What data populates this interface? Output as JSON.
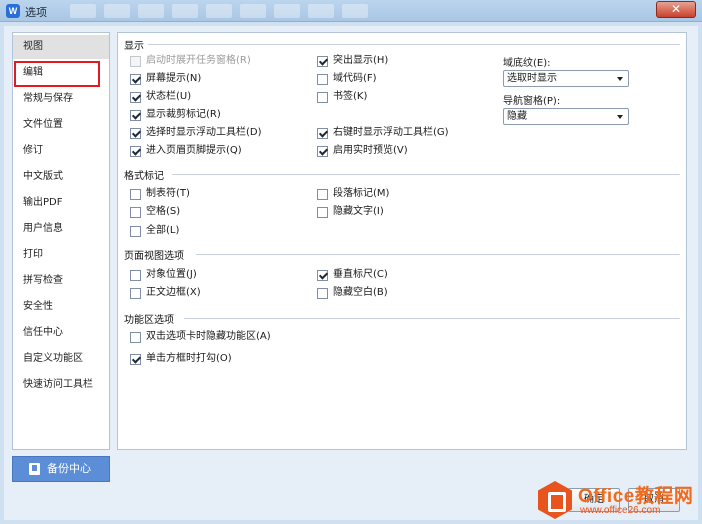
{
  "window": {
    "title": "选项",
    "close_glyph": "✕",
    "app_icon_glyph": "W"
  },
  "sidebar": {
    "selected_index": 0,
    "items": [
      {
        "label": "视图"
      },
      {
        "label": "编辑"
      },
      {
        "label": "常规与保存"
      },
      {
        "label": "文件位置"
      },
      {
        "label": "修订"
      },
      {
        "label": "中文版式"
      },
      {
        "label": "输出PDF"
      },
      {
        "label": "用户信息"
      },
      {
        "label": "打印"
      },
      {
        "label": "拼写检查"
      },
      {
        "label": "安全性"
      },
      {
        "label": "信任中心"
      },
      {
        "label": "自定义功能区"
      },
      {
        "label": "快速访问工具栏"
      }
    ]
  },
  "display": {
    "title": "显示",
    "options": [
      {
        "label": "启动时展开任务窗格(R)",
        "checked": false,
        "disabled": true
      },
      {
        "label": "屏幕提示(N)",
        "checked": true,
        "disabled": false
      },
      {
        "label": "状态栏(U)",
        "checked": true,
        "disabled": false
      },
      {
        "label": "显示裁剪标记(R)",
        "checked": true,
        "disabled": false
      },
      {
        "label": "选择时显示浮动工具栏(D)",
        "checked": true,
        "disabled": false
      },
      {
        "label": "进入页眉页脚提示(Q)",
        "checked": true,
        "disabled": false
      },
      {
        "label": "突出显示(H)",
        "checked": true,
        "disabled": false
      },
      {
        "label": "域代码(F)",
        "checked": false,
        "disabled": false
      },
      {
        "label": "书签(K)",
        "checked": false,
        "disabled": false
      },
      {
        "label": "右键时显示浮动工具栏(G)",
        "checked": true,
        "disabled": false
      },
      {
        "label": "启用实时预览(V)",
        "checked": true,
        "disabled": false
      }
    ],
    "field_shading": {
      "label": "域底纹(E):",
      "value": "选取时显示"
    },
    "nav_pane": {
      "label": "导航窗格(P):",
      "value": "隐藏"
    }
  },
  "format_marks": {
    "title": "格式标记",
    "options": [
      {
        "label": "制表符(T)",
        "checked": false
      },
      {
        "label": "空格(S)",
        "checked": false
      },
      {
        "label": "全部(L)",
        "checked": false
      },
      {
        "label": "段落标记(M)",
        "checked": false
      },
      {
        "label": "隐藏文字(I)",
        "checked": false
      }
    ]
  },
  "page_view": {
    "title": "页面视图选项",
    "options": [
      {
        "label": "对象位置(J)",
        "checked": false
      },
      {
        "label": "正文边框(X)",
        "checked": false
      },
      {
        "label": "垂直标尺(C)",
        "checked": true
      },
      {
        "label": "隐藏空白(B)",
        "checked": false
      }
    ]
  },
  "ribbon": {
    "title": "功能区选项",
    "options": [
      {
        "label": "双击选项卡时隐藏功能区(A)",
        "checked": false
      },
      {
        "label": "单击方框时打勾(O)",
        "checked": true
      }
    ]
  },
  "backup_button": {
    "label": "备份中心"
  },
  "footer": {
    "ok_label": "确定",
    "cancel_label": "取消"
  },
  "watermark": {
    "brand": "Office教程网",
    "url": "www.office26.com"
  },
  "colors": {
    "accent": "#5b8ed6",
    "highlight_border": "#e11b22",
    "selected_bg": "#e1e1e1",
    "watermark": "#f06b1f"
  }
}
